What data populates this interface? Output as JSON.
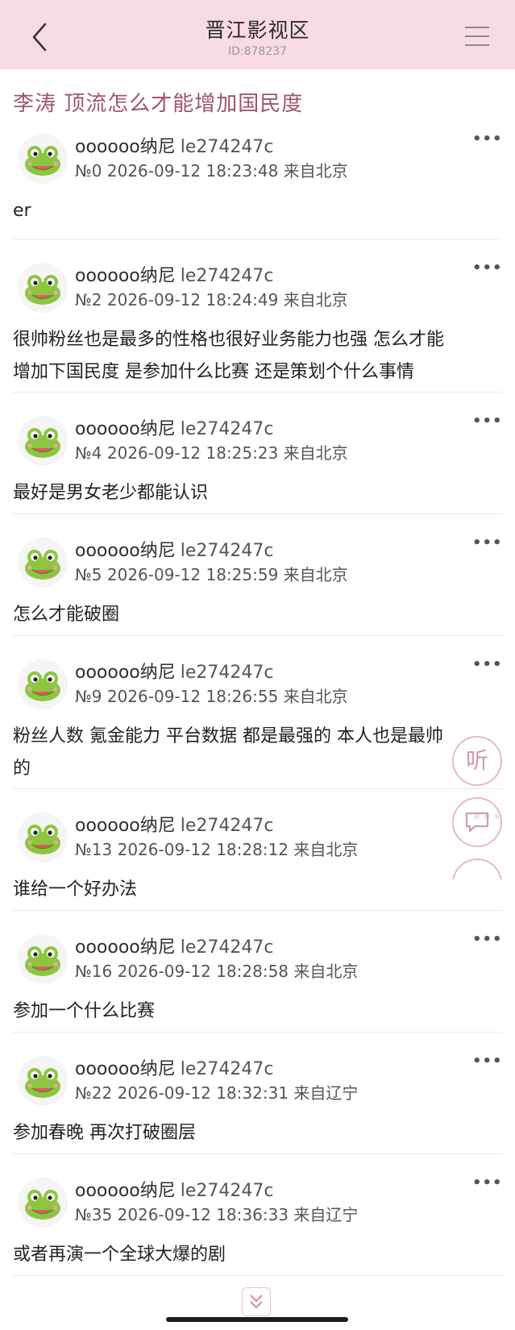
{
  "header": {
    "title": "晋江影视区",
    "id_label": "ID:878237"
  },
  "thread": {
    "title": "李涛 顶流怎么才能增加国民度"
  },
  "posts": [
    {
      "username": "oooooo纳尼",
      "user_id": "le274247c",
      "meta": "№0 2026-09-12 18:23:48 来自北京",
      "content": "er"
    },
    {
      "username": "oooooo纳尼",
      "user_id": "le274247c",
      "meta": "№2 2026-09-12 18:24:49 来自北京",
      "content_lines": [
        "很帅粉丝也是最多的性格也很好业务能力也强 怎么才能",
        "增加下国民度 是参加什么比赛 还是策划个什么事情"
      ]
    },
    {
      "username": "oooooo纳尼",
      "user_id": "le274247c",
      "meta": "№4 2026-09-12 18:25:23 来自北京",
      "content": "最好是男女老少都能认识"
    },
    {
      "username": "oooooo纳尼",
      "user_id": "le274247c",
      "meta": "№5 2026-09-12 18:25:59 来自北京",
      "content": "怎么才能破圈"
    },
    {
      "username": "oooooo纳尼",
      "user_id": "le274247c",
      "meta": "№9 2026-09-12 18:26:55 来自北京",
      "content_lines": [
        "粉丝人数 氪金能力 平台数据 都是最强的 本人也是最帅",
        "的"
      ]
    },
    {
      "username": "oooooo纳尼",
      "user_id": "le274247c",
      "meta": "№13 2026-09-12 18:28:12 来自北京",
      "content": "谁给一个好办法"
    },
    {
      "username": "oooooo纳尼",
      "user_id": "le274247c",
      "meta": "№16 2026-09-12 18:28:58 来自北京",
      "content": "参加一个什么比赛"
    },
    {
      "username": "oooooo纳尼",
      "user_id": "le274247c",
      "meta": "№22 2026-09-12 18:32:31 来自辽宁",
      "content": "参加春晚 再次打破圈层"
    },
    {
      "username": "oooooo纳尼",
      "user_id": "le274247c",
      "meta": "№35 2026-09-12 18:36:33 来自辽宁",
      "content": "或者再演一个全球大爆的剧"
    }
  ],
  "more_label": "•••",
  "floating": {
    "listen_label": "听"
  },
  "colors": {
    "header_bg": "#f9dbe5",
    "title_accent": "#a0556a",
    "float_border": "#e8b9c6"
  },
  "icons": [
    "back-arrow-icon",
    "hamburger-menu-icon",
    "frog-avatar-icon",
    "more-dots-icon",
    "comment-bubble-icon",
    "double-chevron-down-icon"
  ]
}
